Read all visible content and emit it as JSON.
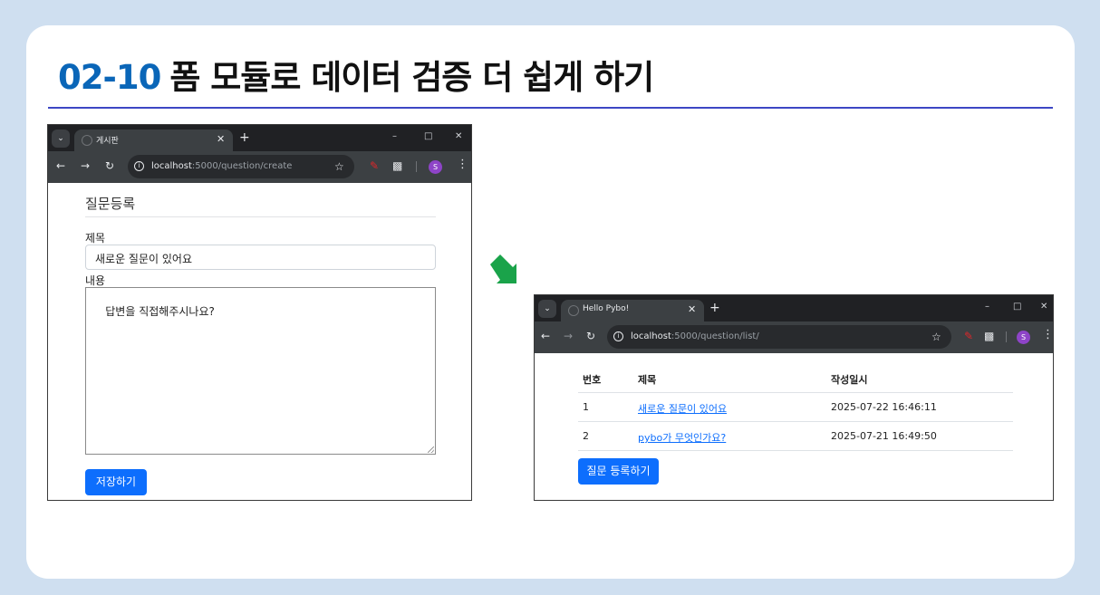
{
  "slide": {
    "number": "02-10",
    "title": "폼 모듈로 데이터 검증 더 쉽게 하기"
  },
  "left_browser": {
    "tab_title": "게시판",
    "url_host": "localhost",
    "url_path": ":5000/question/create",
    "avatar": "S",
    "page": {
      "heading": "질문등록",
      "subject_label": "제목",
      "subject_value": "새로운 질문이 있어요",
      "content_label": "내용",
      "content_value": "답변을 직접해주시나요?",
      "save_button": "저장하기"
    }
  },
  "right_browser": {
    "tab_title": "Hello Pybo!",
    "url_host": "localhost",
    "url_path": ":5000/question/list/",
    "avatar": "S",
    "page": {
      "columns": [
        "번호",
        "제목",
        "작성일시"
      ],
      "rows": [
        {
          "no": "1",
          "subject": "새로운 질문이 있어요",
          "date": "2025-07-22 16:46:11"
        },
        {
          "no": "2",
          "subject": "pybo가 무엇인가요?",
          "date": "2025-07-21 16:49:50"
        }
      ],
      "register_button": "질문 등록하기"
    }
  },
  "icons": {
    "tab_search": "chevron-down-icon",
    "arrow": "down-right-arrow-icon",
    "arrow_color": "#1aa34a"
  },
  "colors": {
    "accent_number": "#0a66b8",
    "title_rule": "#3c46c4",
    "primary_button": "#0d6efd"
  }
}
